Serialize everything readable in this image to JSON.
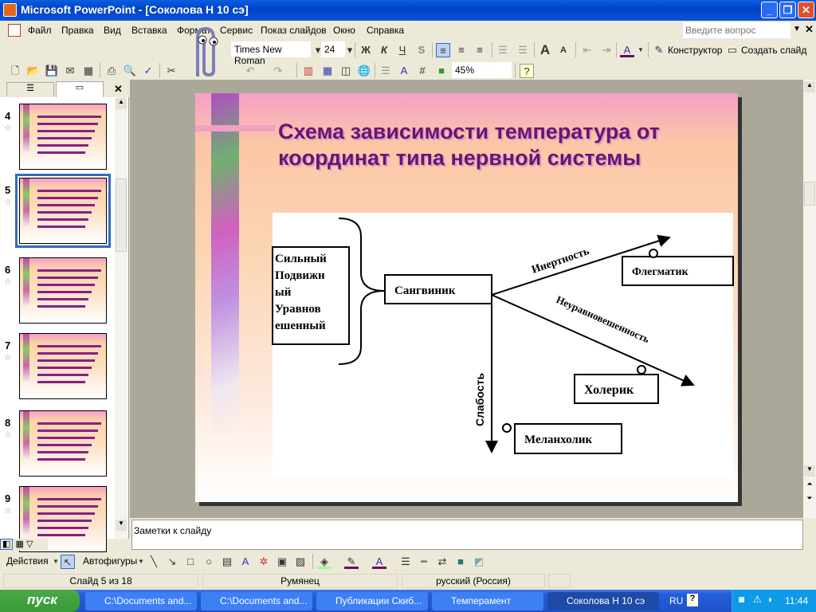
{
  "window": {
    "title": "Microsoft PowerPoint - [Соколова Н 10 сэ]"
  },
  "menu": [
    "Файл",
    "Правка",
    "Вид",
    "Вставка",
    "Формат",
    "Сервис",
    "Показ слайдов",
    "Окно",
    "Справка"
  ],
  "help_search": {
    "placeholder": "Введите вопрос"
  },
  "formatting": {
    "font": "Times New Roman",
    "size": "24",
    "bold": "Ж",
    "italic": "К",
    "underline": "Ч",
    "shadow": "S",
    "designer": "Конструктор",
    "new_slide": "Создать слайд"
  },
  "standard": {
    "zoom": "45%"
  },
  "thumbnails": [
    {
      "num": "4"
    },
    {
      "num": "5",
      "selected": true
    },
    {
      "num": "6"
    },
    {
      "num": "7"
    },
    {
      "num": "8"
    },
    {
      "num": "9"
    }
  ],
  "slide": {
    "title": "Схема зависимости температура от координат типа нервной системы",
    "left_box": [
      "Сильный",
      "Подвижн",
      "ый",
      "Уравнов",
      "ешенный"
    ],
    "center": "Сангвиник",
    "arrows": {
      "up": "Инертность",
      "down": "Неуравновешенность",
      "vertical": "Слабость"
    },
    "types": {
      "phlegmatic": "Флегматик",
      "choleric": "Холерик",
      "melancholic": "Меланхолик"
    },
    "title_color": "#6a1470"
  },
  "notes": {
    "placeholder": "Заметки к слайду"
  },
  "drawing": {
    "actions": "Действия",
    "autoshapes": "Автофигуры"
  },
  "status": {
    "slide": "Слайд 5 из 18",
    "design": "Румянец",
    "language": "русский (Россия)"
  },
  "taskbar": {
    "start": "пуск",
    "tasks": [
      "C:\\Documents and...",
      "C:\\Documents and...",
      "Публикации Скиб...",
      "Темперамент",
      "Соколова Н 10 сэ"
    ],
    "lang": "RU",
    "clock": "11:44"
  }
}
